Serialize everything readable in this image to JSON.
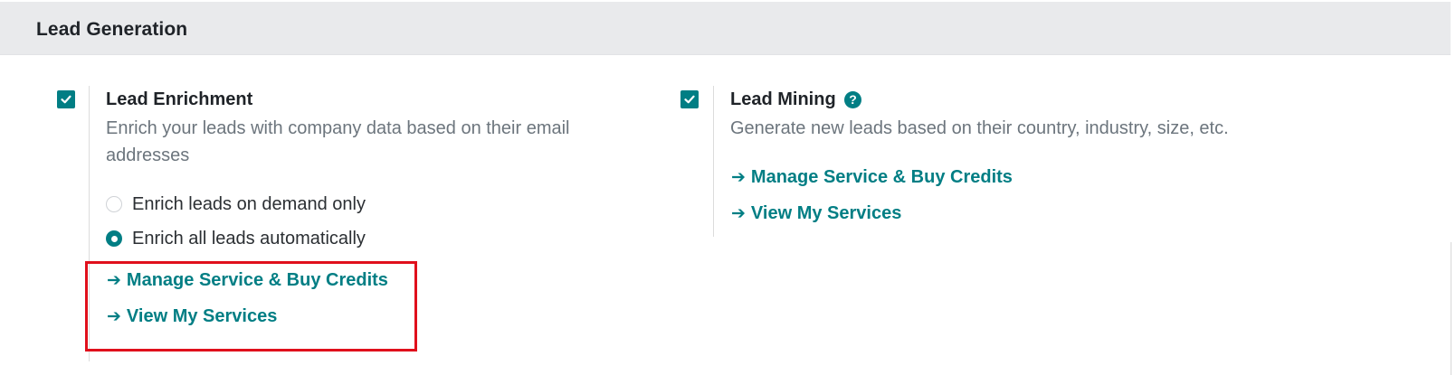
{
  "section": {
    "title": "Lead Generation"
  },
  "lead_enrichment": {
    "checked": true,
    "title": "Lead Enrichment",
    "description": "Enrich your leads with company data based on their email addresses",
    "options": [
      {
        "label": "Enrich leads on demand only",
        "selected": false
      },
      {
        "label": "Enrich all leads automatically",
        "selected": true
      }
    ],
    "links": {
      "manage_label": "Manage Service & Buy Credits",
      "view_label": "View My Services"
    }
  },
  "lead_mining": {
    "checked": true,
    "title": "Lead Mining",
    "help_icon": "question-circle",
    "description": "Generate new leads based on their country, industry, size, etc.",
    "links": {
      "manage_label": "Manage Service & Buy Credits",
      "view_label": "View My Services"
    }
  },
  "link_arrow": "➔",
  "colors": {
    "accent": "#017e84",
    "header_bg": "#e9eaec",
    "highlight": "#e0101c"
  }
}
